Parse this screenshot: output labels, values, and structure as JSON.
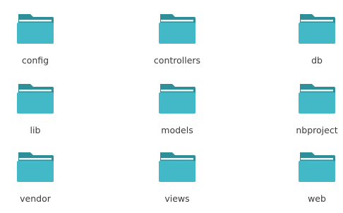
{
  "colors": {
    "folder_back": "#2e8f99",
    "folder_front": "#43b8c6",
    "folder_strip": "#e9f6f8",
    "label_text": "#3a3a3a"
  },
  "icon": "folder-icon",
  "folders": [
    {
      "name": "config"
    },
    {
      "name": "controllers"
    },
    {
      "name": "db"
    },
    {
      "name": "lib"
    },
    {
      "name": "models"
    },
    {
      "name": "nbproject"
    },
    {
      "name": "vendor"
    },
    {
      "name": "views"
    },
    {
      "name": "web"
    }
  ]
}
